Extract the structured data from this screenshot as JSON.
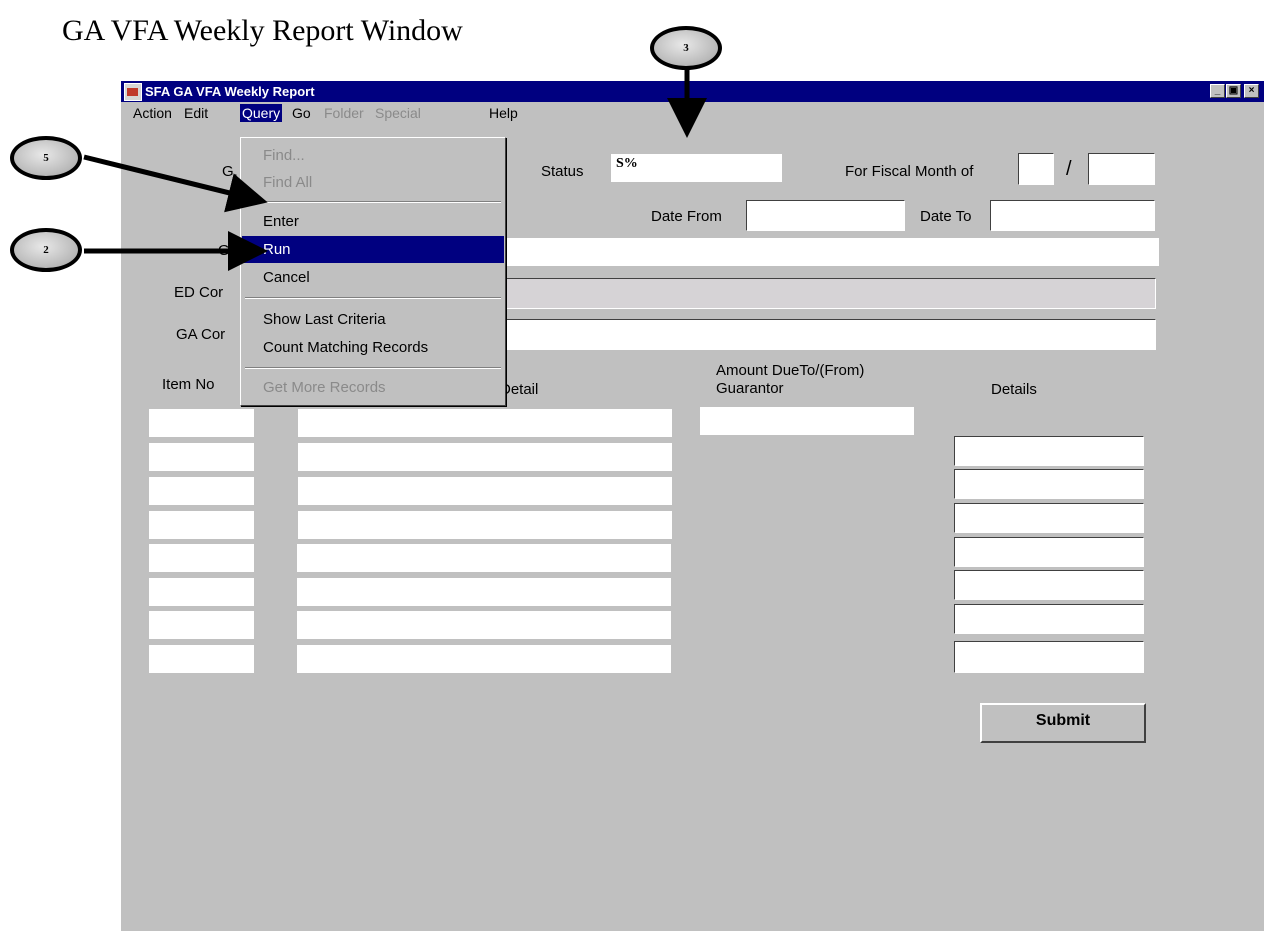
{
  "doc_title": "GA VFA Weekly Report Window",
  "window": {
    "title": "SFA GA VFA Weekly Report"
  },
  "menubar": [
    {
      "label": "Action",
      "state": "normal"
    },
    {
      "label": "Edit",
      "state": "normal"
    },
    {
      "label": "Query",
      "state": "active"
    },
    {
      "label": "Go",
      "state": "normal"
    },
    {
      "label": "Folder",
      "state": "disabled"
    },
    {
      "label": "Special",
      "state": "disabled"
    },
    {
      "label": "Help",
      "state": "normal"
    }
  ],
  "query_menu": {
    "find": "Find...",
    "find_all": "Find All",
    "enter": "Enter",
    "run": "Run",
    "cancel": "Cancel",
    "show_last_criteria": "Show Last Criteria",
    "count_matching": "Count Matching Records",
    "get_more": "Get More Records"
  },
  "form": {
    "ga_label_partial": "G.",
    "status_label": "Status",
    "status_value": "S%",
    "fiscal_label": "For Fiscal Month of",
    "fiscal_sep": "/",
    "date_from_label": "Date From",
    "date_to_label": "Date To",
    "ga_label_partial2": "GA",
    "ed_comment_label_partial": "ED Cor",
    "ga_comment_label_partial": "GA Cor"
  },
  "columns": {
    "item_no": "Item No",
    "detail": "Detail",
    "amount_due": "Amount DueTo/(From) Guarantor",
    "details": "Details"
  },
  "submit_label": "Submit",
  "callouts": {
    "c3": "3",
    "c5": "5",
    "c2": "2"
  }
}
